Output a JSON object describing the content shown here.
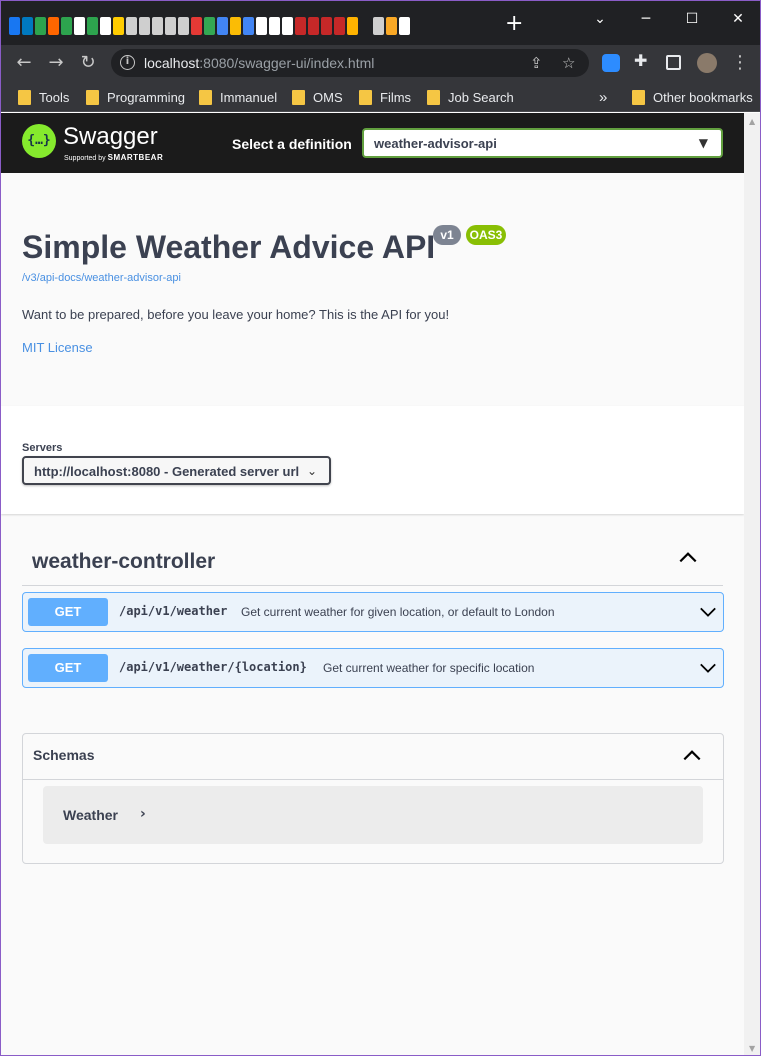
{
  "browser": {
    "url_host": "localhost",
    "url_rest": ":8080/swagger-ui/index.html",
    "new_tab": "+",
    "bookmarks": [
      "Tools",
      "Programming",
      "Immanuel",
      "OMS",
      "Films",
      "Job Search"
    ],
    "other_bookmarks": "Other bookmarks",
    "overflow": "»"
  },
  "topbar": {
    "logo_text": "Swagger",
    "logo_sub_prefix": "Supported by",
    "logo_sub_brand": "SMARTBEAR",
    "logo_icon": "{…}",
    "select_label": "Select a definition",
    "selected_definition": "weather-advisor-api"
  },
  "info": {
    "title": "Simple Weather Advice API",
    "version_badge": "v1",
    "oas_badge": "OAS3",
    "spec_link": "/v3/api-docs/weather-advisor-api",
    "description": "Want to be prepared, before you leave your home? This is the API for you!",
    "license": "MIT License"
  },
  "servers": {
    "label": "Servers",
    "selected": "http://localhost:8080 - Generated server url"
  },
  "controller": {
    "title": "weather-controller",
    "operations": [
      {
        "method": "GET",
        "path": "/api/v1/weather",
        "summary": "Get current weather for given location, or default to London"
      },
      {
        "method": "GET",
        "path": "/api/v1/weather/{location}",
        "summary": "Get current weather for specific location"
      }
    ]
  },
  "schemas": {
    "title": "Schemas",
    "models": [
      {
        "name": "Weather"
      }
    ]
  },
  "colors": {
    "get_method": "#61affe",
    "get_bg": "#ebf3fb",
    "swagger_green": "#85ea2d",
    "oas_badge": "#89bf04",
    "link": "#4990e2"
  }
}
